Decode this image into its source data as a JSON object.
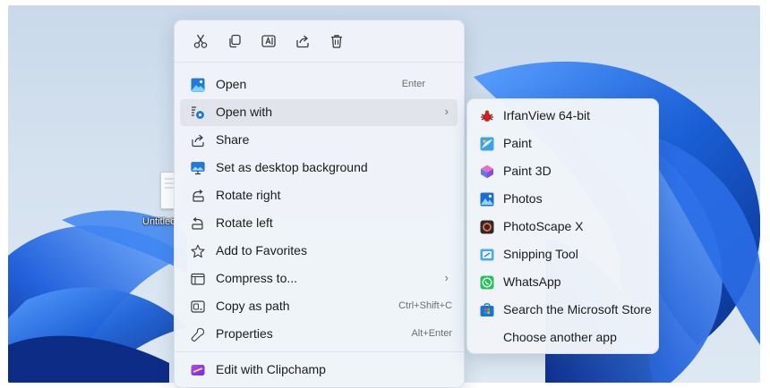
{
  "desktop": {
    "file_label": "Untitled"
  },
  "toolbar": {
    "cut_icon": "scissors-icon",
    "copy_icon": "copy-icon",
    "rename_icon": "rename-icon",
    "share_icon": "share-icon",
    "delete_icon": "trash-icon"
  },
  "menu": {
    "items": [
      {
        "label": "Open",
        "shortcut": "Enter",
        "icon": "image-icon"
      },
      {
        "label": "Open with",
        "shortcut": "",
        "icon": "open-with-icon",
        "arrow": "›"
      },
      {
        "label": "Share",
        "shortcut": "",
        "icon": "share-icon"
      },
      {
        "label": "Set as desktop background",
        "shortcut": "",
        "icon": "desktop-background-icon"
      },
      {
        "label": "Rotate right",
        "shortcut": "",
        "icon": "rotate-right-icon"
      },
      {
        "label": "Rotate left",
        "shortcut": "",
        "icon": "rotate-left-icon"
      },
      {
        "label": "Add to Favorites",
        "shortcut": "",
        "icon": "star-icon"
      },
      {
        "label": "Compress to...",
        "shortcut": "",
        "icon": "zip-folder-icon",
        "arrow": "›"
      },
      {
        "label": "Copy as path",
        "shortcut": "Ctrl+Shift+C",
        "icon": "copy-path-icon"
      },
      {
        "label": "Properties",
        "shortcut": "Alt+Enter",
        "icon": "wrench-icon"
      },
      {
        "label": "Edit with Clipchamp",
        "shortcut": "",
        "icon": "clipchamp-icon"
      }
    ]
  },
  "submenu": {
    "items": [
      {
        "label": "IrfanView 64-bit",
        "icon": "irfanview-icon"
      },
      {
        "label": "Paint",
        "icon": "paint-icon"
      },
      {
        "label": "Paint 3D",
        "icon": "paint3d-icon"
      },
      {
        "label": "Photos",
        "icon": "photos-icon"
      },
      {
        "label": "PhotoScape X",
        "icon": "photoscape-icon"
      },
      {
        "label": "Snipping Tool",
        "icon": "snipping-tool-icon"
      },
      {
        "label": "WhatsApp",
        "icon": "whatsapp-icon"
      },
      {
        "label": "Search the Microsoft Store",
        "icon": "microsoft-store-icon"
      },
      {
        "label": "Choose another app",
        "icon": ""
      }
    ]
  },
  "colors": {
    "accent": "#0067c0",
    "wallpaper_bloom": "#1a5fd6",
    "wallpaper_bg": "#d5e2ef"
  }
}
